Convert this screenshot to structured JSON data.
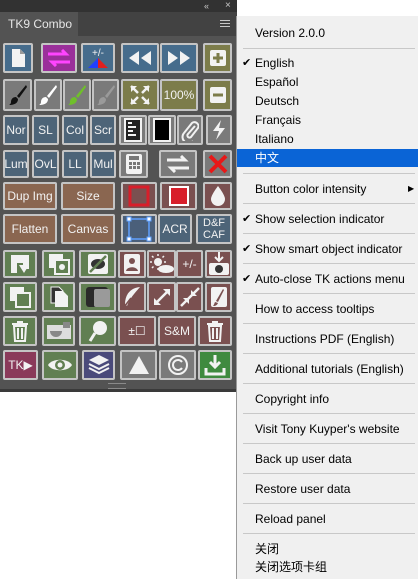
{
  "panel": {
    "tab_title": "TK9 Combo",
    "collapse_label": "«",
    "close_label": "×",
    "buttons": [
      {
        "name": "new-document-button",
        "label": "",
        "icon": "new-document-icon",
        "bg": "#466c8c"
      },
      {
        "name": "swap-layers-button",
        "label": "",
        "icon": "swap-arrows-icon",
        "bg": "#9a2f9a"
      },
      {
        "name": "plus-minus-mask-button",
        "label": "",
        "icon": "plus-minus-mask-icon",
        "bg": "#466c8c"
      },
      {
        "name": "rewind-button",
        "label": "",
        "icon": "rewind-icon",
        "bg": "#466c8c"
      },
      {
        "name": "fast-forward-button",
        "label": "",
        "icon": "fast-forward-icon",
        "bg": "#466c8c"
      },
      {
        "name": "add-button",
        "label": "",
        "icon": "plus-box-icon",
        "bg": "#7c7c4a"
      },
      {
        "name": "black-brush-button",
        "label": "",
        "icon": "brush-icon",
        "bg": "#7a7a7a"
      },
      {
        "name": "white-brush-button",
        "label": "",
        "icon": "brush-icon",
        "bg": "#7a7a7a"
      },
      {
        "name": "green-brush-button",
        "label": "",
        "icon": "brush-icon",
        "bg": "#7a7a7a"
      },
      {
        "name": "gray-brush-button",
        "label": "",
        "icon": "brush-icon",
        "bg": "#7a7a7a"
      },
      {
        "name": "fit-screen-button",
        "label": "",
        "icon": "expand-arrows-icon",
        "bg": "#7c7c4a"
      },
      {
        "name": "zoom-100-button",
        "label": "100%",
        "icon": "",
        "bg": "#7c7c4a"
      },
      {
        "name": "remove-button",
        "label": "",
        "icon": "minus-box-icon",
        "bg": "#7c7c4a"
      },
      {
        "name": "normal-mode-button",
        "label": "Nor",
        "icon": "",
        "bg": "#4d6478"
      },
      {
        "name": "soft-light-button",
        "label": "SL",
        "icon": "",
        "bg": "#4d6478"
      },
      {
        "name": "color-mode-button",
        "label": "Col",
        "icon": "",
        "bg": "#4d6478"
      },
      {
        "name": "screen-mode-button",
        "label": "Scr",
        "icon": "",
        "bg": "#4d6478"
      },
      {
        "name": "layer-mask-button",
        "label": "",
        "icon": "layer-mask-icon",
        "bg": "#7a7a7a"
      },
      {
        "name": "black-mask-button",
        "label": "",
        "icon": "black-mask-icon",
        "bg": "#7a7a7a"
      },
      {
        "name": "paperclip-button",
        "label": "",
        "icon": "paperclip-icon",
        "bg": "#7a7a7a"
      },
      {
        "name": "flash-button",
        "label": "",
        "icon": "lightning-icon",
        "bg": "#7a7a7a"
      },
      {
        "name": "luminosity-button",
        "label": "Lum",
        "icon": "",
        "bg": "#4d6478"
      },
      {
        "name": "overlay-button",
        "label": "OvL",
        "icon": "",
        "bg": "#4d6478"
      },
      {
        "name": "linear-light-button",
        "label": "LL",
        "icon": "",
        "bg": "#4d6478"
      },
      {
        "name": "multiply-button",
        "label": "Mul",
        "icon": "",
        "bg": "#4d6478"
      },
      {
        "name": "calculator-button",
        "label": "",
        "icon": "calculator-icon",
        "bg": "#7a7a7a"
      },
      {
        "name": "exchange-button",
        "label": "",
        "icon": "exchange-arrows-icon",
        "bg": "#7a7a7a"
      },
      {
        "name": "delete-x-button",
        "label": "",
        "icon": "red-x-icon",
        "bg": "#7a7a7a"
      },
      {
        "name": "duplicate-image-button",
        "label": "Dup Img",
        "icon": "",
        "bg": "#8a6650"
      },
      {
        "name": "size-button",
        "label": "Size",
        "icon": "",
        "bg": "#8a6650"
      },
      {
        "name": "red-outline-button",
        "label": "",
        "icon": "red-outline-square-icon",
        "bg": "#7a5050"
      },
      {
        "name": "red-fill-button",
        "label": "",
        "icon": "red-filled-square-icon",
        "bg": "#7a5050"
      },
      {
        "name": "drop-button",
        "label": "",
        "icon": "drop-icon",
        "bg": "#7a5050"
      },
      {
        "name": "flatten-button",
        "label": "Flatten",
        "icon": "",
        "bg": "#8a6650"
      },
      {
        "name": "canvas-button",
        "label": "Canvas",
        "icon": "",
        "bg": "#8a6650"
      },
      {
        "name": "selection-box-button",
        "label": "",
        "icon": "selection-box-icon",
        "bg": "#4a5f7a"
      },
      {
        "name": "acr-button",
        "label": "ACR",
        "icon": "",
        "bg": "#4d6478"
      },
      {
        "name": "dodge-burn-button",
        "label": "D&F CAF",
        "icon": "",
        "bg": "#4d6478"
      },
      {
        "name": "stamp-layer-button",
        "label": "",
        "icon": "stamp-icon",
        "bg": "#617f52"
      },
      {
        "name": "smart-object-button",
        "label": "",
        "icon": "smart-object-icon",
        "bg": "#617f52"
      },
      {
        "name": "hide-mask-button",
        "label": "",
        "icon": "mask-slash-icon",
        "bg": "#617f52"
      },
      {
        "name": "portrait-button",
        "label": "",
        "icon": "portrait-icon",
        "bg": "#7a5050"
      },
      {
        "name": "weather-button",
        "label": "",
        "icon": "sun-cloud-icon",
        "bg": "#7a5050"
      },
      {
        "name": "plus-minus-button",
        "label": "+/-",
        "icon": "",
        "bg": "#7a5050"
      },
      {
        "name": "import-button",
        "label": "",
        "icon": "import-camera-icon",
        "bg": "#7a5050"
      },
      {
        "name": "duplicate-layer-button",
        "label": "",
        "icon": "duplicate-icon",
        "bg": "#617f52"
      },
      {
        "name": "copy-file-button",
        "label": "",
        "icon": "file-copy-icon",
        "bg": "#617f52"
      },
      {
        "name": "layer-stack-button",
        "label": "",
        "icon": "layer-stack-icon",
        "bg": "#617f52"
      },
      {
        "name": "feather-button",
        "label": "",
        "icon": "feather-icon",
        "bg": "#7a5050"
      },
      {
        "name": "expand-button",
        "label": "",
        "icon": "diagonal-expand-icon",
        "bg": "#7a5050"
      },
      {
        "name": "contract-button",
        "label": "",
        "icon": "diagonal-contract-icon",
        "bg": "#7a5050"
      },
      {
        "name": "brush-edit-button",
        "label": "",
        "icon": "brush-edit-icon",
        "bg": "#7a5050"
      },
      {
        "name": "trash-button",
        "label": "",
        "icon": "trash-icon",
        "bg": "#617f52"
      },
      {
        "name": "mask-tool-button",
        "label": "",
        "icon": "mask-tool-icon",
        "bg": "#617f52"
      },
      {
        "name": "magnify-button",
        "label": "",
        "icon": "magnify-icon",
        "bg": "#617f52"
      },
      {
        "name": "selection-adjust-button",
        "label": "±☐",
        "icon": "",
        "bg": "#7a5050"
      },
      {
        "name": "smooth-merge-button",
        "label": "S&M",
        "icon": "",
        "bg": "#7a5050"
      },
      {
        "name": "trash-red-button",
        "label": "",
        "icon": "trash-icon",
        "bg": "#7a5050"
      },
      {
        "name": "tk-play-button",
        "label": "TK▶",
        "icon": "",
        "bg": "#8a3a5a"
      },
      {
        "name": "eye-button",
        "label": "",
        "icon": "eye-icon",
        "bg": "#617f52"
      },
      {
        "name": "layers-button",
        "label": "",
        "icon": "layers-icon",
        "bg": "#4a4a7a"
      },
      {
        "name": "triangle-button",
        "label": "",
        "icon": "triangle-icon",
        "bg": "#7a7a7a"
      },
      {
        "name": "copyright-button",
        "label": "",
        "icon": "copyright-icon",
        "bg": "#7a7a7a"
      },
      {
        "name": "download-button",
        "label": "",
        "icon": "download-icon",
        "bg": "#3f8a3f"
      }
    ]
  },
  "menu": {
    "version": "Version 2.0.0",
    "languages": [
      "English",
      "Español",
      "Deutsch",
      "Français",
      "Italiano",
      "中文"
    ],
    "checked_language": "English",
    "selected_language": "中文",
    "items": [
      {
        "label": "Button color intensity",
        "checked": false,
        "submenu": true
      },
      {
        "label": "Show selection indicator",
        "checked": true,
        "submenu": false
      },
      {
        "label": "Show smart object indicator",
        "checked": true,
        "submenu": false
      },
      {
        "label": "Auto-close TK actions menu",
        "checked": true,
        "submenu": false
      },
      {
        "label": "How to access tooltips",
        "checked": false,
        "submenu": false
      },
      {
        "label": "Instructions PDF (English)",
        "checked": false,
        "submenu": false
      },
      {
        "label": "Additional tutorials (English)",
        "checked": false,
        "submenu": false
      },
      {
        "label": "Copyright info",
        "checked": false,
        "submenu": false
      },
      {
        "label": "Visit Tony Kuyper's website",
        "checked": false,
        "submenu": false
      },
      {
        "label": "Back up user data",
        "checked": false,
        "submenu": false
      },
      {
        "label": "Restore user data",
        "checked": false,
        "submenu": false
      },
      {
        "label": "Reload panel",
        "checked": false,
        "submenu": false
      }
    ],
    "footer": [
      "关闭",
      "关闭选项卡组"
    ]
  }
}
